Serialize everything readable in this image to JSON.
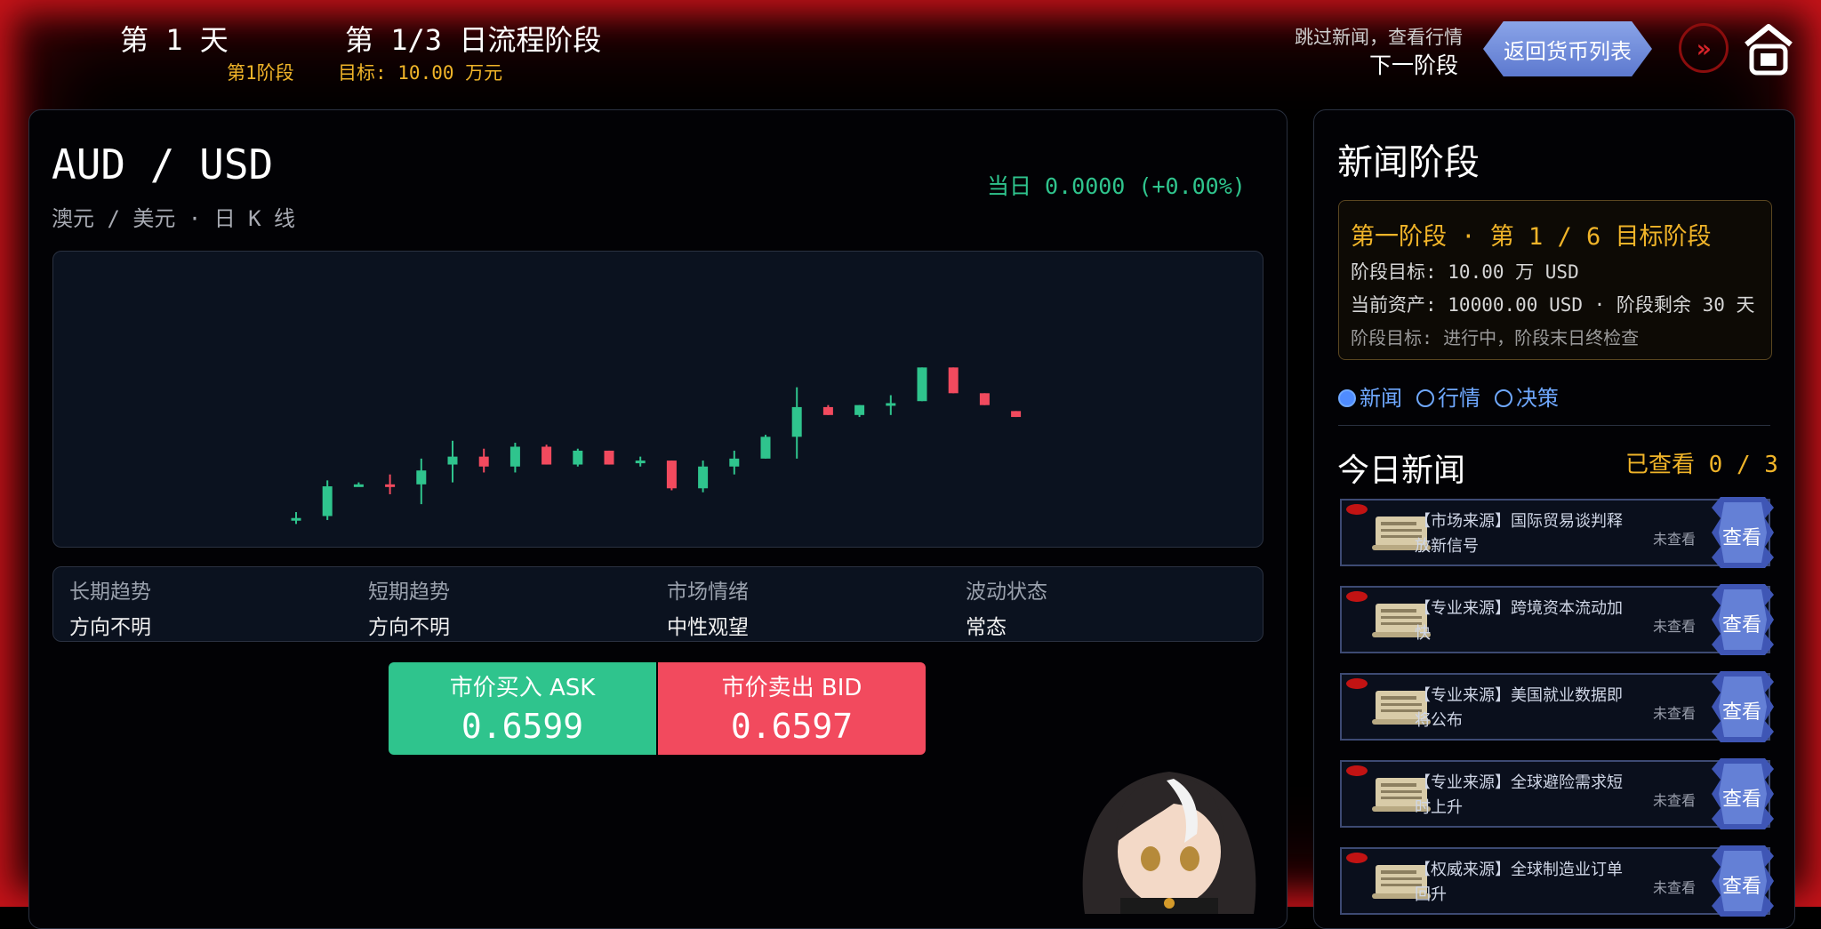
{
  "topbar": {
    "day": "第 1 天",
    "phase": "第 1/3 日流程阶段",
    "stage_label": "第1阶段",
    "target_label": "目标: 10.00 万元",
    "skip_hint": "跳过新闻，查看行情",
    "next_phase": "下一阶段",
    "back_button": "返回货币列表",
    "fast_forward_icon": "fast-forward-icon",
    "home_icon": "home-icon"
  },
  "main": {
    "pair": "AUD / USD",
    "pair_sub": "澳元 / 美元 · 日 K 线",
    "day_change": "当日  0.0000  (+0.00%)",
    "stats": [
      {
        "label": "长期趋势",
        "value": "方向不明"
      },
      {
        "label": "短期趋势",
        "value": "方向不明"
      },
      {
        "label": "市场情绪",
        "value": "中性观望"
      },
      {
        "label": "波动状态",
        "value": "常态"
      }
    ],
    "buy": {
      "label": "市价买入  ASK",
      "price": "0.6599"
    },
    "sell": {
      "label": "市价卖出  BID",
      "price": "0.6597"
    }
  },
  "chart_data": {
    "type": "candlestick",
    "title": "",
    "xlabel": "",
    "ylabel": "",
    "grid": false,
    "up_color": "#2fc48d",
    "down_color": "#f24a5e",
    "ylim": [
      0.648,
      0.662
    ],
    "candles": [
      {
        "o": 0.649,
        "h": 0.6493,
        "l": 0.6487,
        "c": 0.649
      },
      {
        "o": 0.6491,
        "h": 0.6509,
        "l": 0.6489,
        "c": 0.6506
      },
      {
        "o": 0.6507,
        "h": 0.6508,
        "l": 0.6506,
        "c": 0.6507
      },
      {
        "o": 0.6507,
        "h": 0.6512,
        "l": 0.6502,
        "c": 0.6506
      },
      {
        "o": 0.6507,
        "h": 0.652,
        "l": 0.6497,
        "c": 0.6514
      },
      {
        "o": 0.6517,
        "h": 0.6529,
        "l": 0.6508,
        "c": 0.6521
      },
      {
        "o": 0.6521,
        "h": 0.6525,
        "l": 0.6513,
        "c": 0.6516
      },
      {
        "o": 0.6516,
        "h": 0.6528,
        "l": 0.6513,
        "c": 0.6526
      },
      {
        "o": 0.6526,
        "h": 0.6527,
        "l": 0.6517,
        "c": 0.6517
      },
      {
        "o": 0.6517,
        "h": 0.6525,
        "l": 0.6516,
        "c": 0.6524
      },
      {
        "o": 0.6524,
        "h": 0.6524,
        "l": 0.6517,
        "c": 0.6517
      },
      {
        "o": 0.6518,
        "h": 0.6521,
        "l": 0.6516,
        "c": 0.6519
      },
      {
        "o": 0.6519,
        "h": 0.6519,
        "l": 0.6504,
        "c": 0.6505
      },
      {
        "o": 0.6505,
        "h": 0.6519,
        "l": 0.6503,
        "c": 0.6516
      },
      {
        "o": 0.6516,
        "h": 0.6524,
        "l": 0.6512,
        "c": 0.652
      },
      {
        "o": 0.652,
        "h": 0.6532,
        "l": 0.652,
        "c": 0.6531
      },
      {
        "o": 0.6531,
        "h": 0.6556,
        "l": 0.652,
        "c": 0.6546
      },
      {
        "o": 0.6546,
        "h": 0.6547,
        "l": 0.6542,
        "c": 0.6542
      },
      {
        "o": 0.6542,
        "h": 0.6547,
        "l": 0.6541,
        "c": 0.6547
      },
      {
        "o": 0.6547,
        "h": 0.6552,
        "l": 0.6542,
        "c": 0.6548
      },
      {
        "o": 0.6549,
        "h": 0.6566,
        "l": 0.6549,
        "c": 0.6566
      },
      {
        "o": 0.6566,
        "h": 0.6566,
        "l": 0.6553,
        "c": 0.6553
      },
      {
        "o": 0.6553,
        "h": 0.6553,
        "l": 0.6547,
        "c": 0.6547
      },
      {
        "o": 0.6544,
        "h": 0.6544,
        "l": 0.6541,
        "c": 0.6541
      }
    ]
  },
  "news_panel": {
    "title": "新闻阶段",
    "phase_box": {
      "title": "第一阶段 · 第 1 / 6 目标阶段",
      "line1": "阶段目标: 10.00 万 USD",
      "line2": "当前资产: 10000.00 USD · 阶段剩余 30 天",
      "line3": "阶段目标: 进行中，阶段末日终检查"
    },
    "tabs": [
      "新闻",
      "行情",
      "决策"
    ],
    "today_title": "今日新闻",
    "viewed": "已查看 0 / 3",
    "items": [
      {
        "text": "【市场来源】国际贸易谈判释放新信号",
        "status": "未查看",
        "action": "查看"
      },
      {
        "text": "【专业来源】跨境资本流动加快",
        "status": "未查看",
        "action": "查看"
      },
      {
        "text": "【专业来源】美国就业数据即将公布",
        "status": "未查看",
        "action": "查看"
      },
      {
        "text": "【专业来源】全球避险需求短时上升",
        "status": "未查看",
        "action": "查看"
      },
      {
        "text": "【权威来源】全球制造业订单回升",
        "status": "未查看",
        "action": "查看"
      }
    ]
  },
  "colors": {
    "up": "#2fc48d",
    "down": "#f24a5e",
    "accent_gold": "#f0b429",
    "link_blue": "#6fa8ff"
  }
}
